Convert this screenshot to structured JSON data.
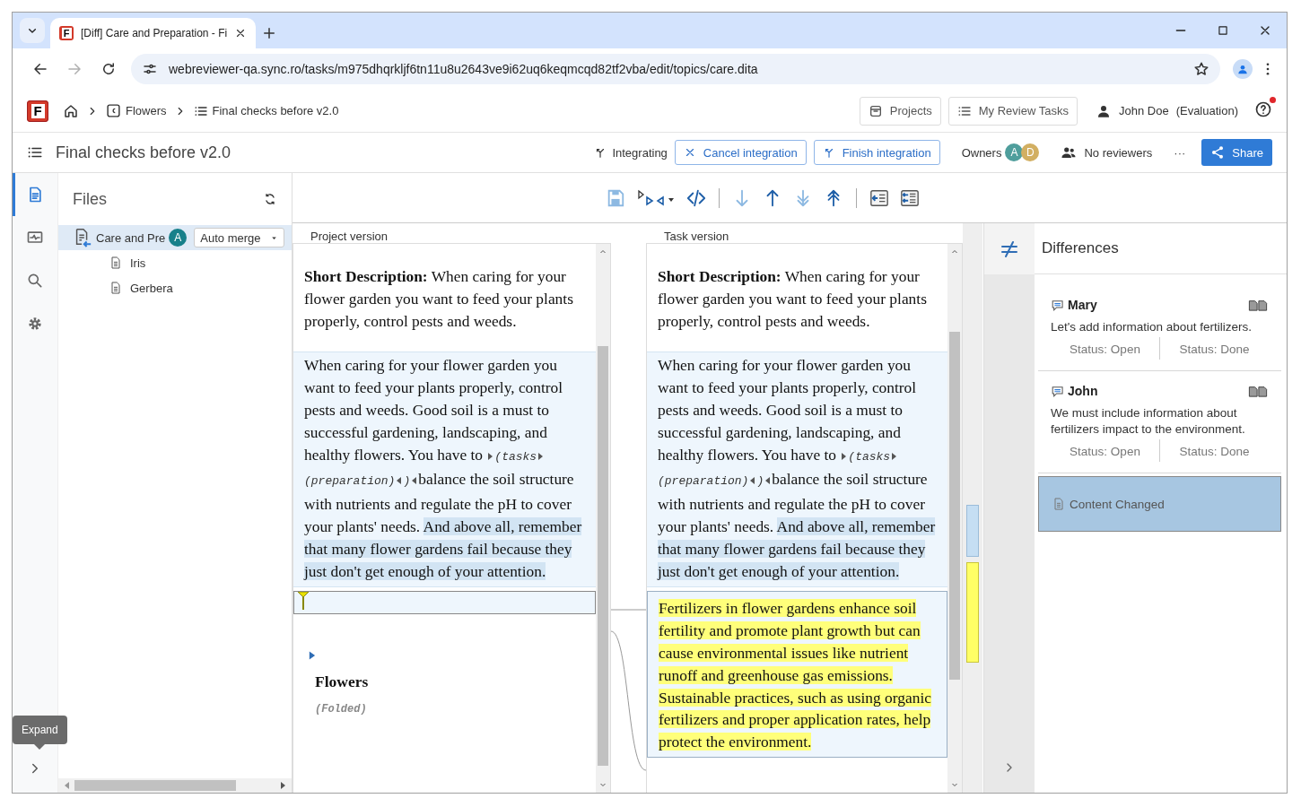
{
  "browser": {
    "tab": {
      "icon_letter": "F",
      "title": "[Diff] Care and Preparation - Fi"
    },
    "url": "webreviewer-qa.sync.ro/tasks/m975dhqrkljf6tn11u8u2643ve9i62uq6keqmcqd82tf2vba/edit/topics/care.dita",
    "forward_disabled": true
  },
  "header": {
    "logo_letter": "F",
    "breadcrumbs": [
      {
        "kind": "collection",
        "label": "Flowers"
      },
      {
        "kind": "task",
        "label": "Final checks before v2.0"
      }
    ],
    "nav_buttons": [
      {
        "kind": "projects",
        "label": "Projects"
      },
      {
        "kind": "tasks",
        "label": "My Review Tasks"
      }
    ],
    "user": {
      "name": "John Doe",
      "note": "(Evaluation)",
      "notification": true
    }
  },
  "task_bar": {
    "title": "Final checks before v2.0",
    "status": "Integrating",
    "actions": [
      {
        "kind": "cancel",
        "label": "Cancel integration"
      },
      {
        "kind": "finish",
        "label": "Finish integration"
      }
    ],
    "owners_label": "Owners",
    "owners": [
      {
        "initial": "A",
        "color": "#4f9e9c"
      },
      {
        "initial": "D",
        "color": "#d2af62"
      }
    ],
    "reviewers": "No reviewers",
    "more": "···",
    "share": "Share"
  },
  "sidebar": {
    "items": [
      {
        "kind": "files",
        "selected": true
      },
      {
        "kind": "activity",
        "selected": false
      },
      {
        "kind": "search",
        "selected": false
      },
      {
        "kind": "settings",
        "selected": false
      }
    ],
    "tooltip": "Expand"
  },
  "files": {
    "title": "Files",
    "tree": [
      {
        "label": "Care and Pre",
        "selected": true,
        "avatar": "A",
        "merge": "Auto merge",
        "children": [
          {
            "label": "Iris",
            "selected": false
          },
          {
            "label": "Gerbera",
            "selected": false
          }
        ]
      }
    ]
  },
  "editor": {
    "toolbar": [
      [
        {
          "kind": "save",
          "disabled": true
        },
        {
          "kind": "merge",
          "disabled": false
        },
        {
          "kind": "code",
          "disabled": false
        }
      ],
      [
        {
          "kind": "next",
          "disabled": true
        },
        {
          "kind": "previous",
          "disabled": false
        },
        {
          "kind": "last",
          "disabled": true
        },
        {
          "kind": "first",
          "disabled": false
        }
      ],
      [
        {
          "kind": "accept",
          "disabled": false
        },
        {
          "kind": "accept-all",
          "disabled": false
        }
      ]
    ],
    "panes": [
      {
        "title": "Project version",
        "short_description": "**Short Description:** When caring for your flower garden you want to feed your plants properly, control pests and weeds.",
        "paragraph": [
          {
            "kind": "text",
            "text": "When caring for your flower garden you want to feed your plants properly, control pests and weeds. Good soil is a must to successful gardening, landscaping, and healthy flowers. You have to "
          },
          {
            "kind": "open-tag",
            "text": "(tasks"
          },
          {
            "kind": "wrap-tag",
            "text": "(preparation)"
          },
          {
            "kind": "close-tag",
            "text": ")"
          },
          {
            "kind": "text",
            "text": "balance the soil structure with nutrients and regulate the pH to cover your plants' needs. "
          },
          {
            "kind": "changed",
            "text": "And above all, remember that many flower gardens fail because they just don't get enough of your attention."
          }
        ],
        "insertion_point": true,
        "folded_section": {
          "title": "Flowers",
          "note": "(Folded)"
        }
      },
      {
        "title": "Task version",
        "short_description": "**Short Description:** When caring for your flower garden you want to feed your plants properly, control pests and weeds.",
        "paragraph": [
          {
            "kind": "text",
            "text": "When caring for your flower garden you want to feed your plants properly, control pests and weeds. Good soil is a must to successful gardening, landscaping, and healthy flowers. You have to "
          },
          {
            "kind": "open-tag",
            "text": "(tasks"
          },
          {
            "kind": "wrap-tag",
            "text": "(preparation)"
          },
          {
            "kind": "close-tag",
            "text": ")"
          },
          {
            "kind": "text",
            "text": "balance the soil structure with nutrients and regulate the pH to cover your plants' needs. "
          },
          {
            "kind": "changed",
            "text": "And above all, remember that many flower gardens fail because they just don't get enough of your attention."
          }
        ],
        "added_paragraph": "Fertilizers in flower gardens enhance soil fertility and promote plant growth but can cause environmental issues like nutrient runoff and greenhouse gas emissions. Sustainable practices, such as using organic fertilizers and proper application rates, help protect the environment."
      }
    ]
  },
  "differences": {
    "title": "Differences",
    "items": [
      {
        "kind": "comment",
        "author": "Mary",
        "text": "Let's add information about fertilizers.",
        "statuses": [
          "Status: Open",
          "Status: Done"
        ],
        "selected": false
      },
      {
        "kind": "comment",
        "author": "John",
        "text": "We must include information about fertilizers impact to the environment.",
        "statuses": [
          "Status: Open",
          "Status: Done"
        ],
        "selected": false
      },
      {
        "kind": "change",
        "label": "Content Changed",
        "selected": true
      }
    ]
  }
}
